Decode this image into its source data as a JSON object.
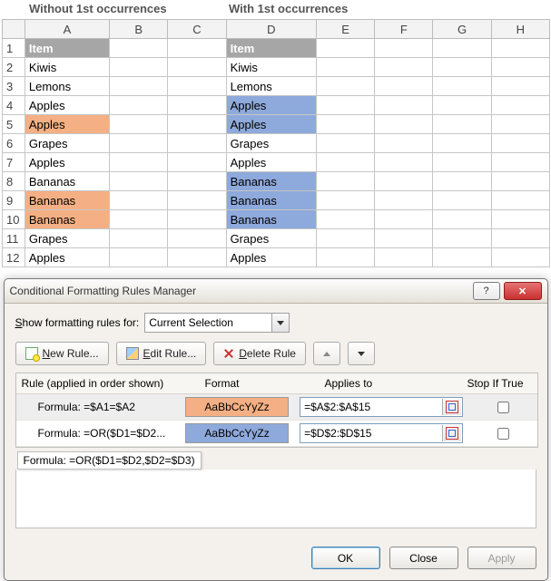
{
  "headings": {
    "left": "Without 1st occurrences",
    "right": "With 1st occurrences"
  },
  "columns": [
    "A",
    "B",
    "C",
    "D",
    "E",
    "F",
    "G",
    "H"
  ],
  "rows": [
    "1",
    "2",
    "3",
    "4",
    "5",
    "6",
    "7",
    "8",
    "9",
    "10",
    "11",
    "12"
  ],
  "colA": {
    "header": "Item",
    "values": [
      "Kiwis",
      "Lemons",
      "Apples",
      "Apples",
      "Grapes",
      "Apples",
      "Bananas",
      "Bananas",
      "Bananas",
      "Grapes",
      "Apples"
    ],
    "highlight_orange_rows": [
      5,
      9,
      10
    ]
  },
  "colD": {
    "header": "Item",
    "values": [
      "Kiwis",
      "Lemons",
      "Apples",
      "Apples",
      "Grapes",
      "Apples",
      "Bananas",
      "Bananas",
      "Bananas",
      "Grapes",
      "Apples"
    ],
    "highlight_blue_rows": [
      4,
      5,
      8,
      9,
      10
    ]
  },
  "dialog": {
    "title": "Conditional Formatting Rules Manager",
    "show_label_pre": "S",
    "show_label_post": "how formatting rules for:",
    "show_value": "Current Selection",
    "buttons": {
      "new": "New Rule...",
      "edit": "Edit Rule...",
      "delete": "Delete Rule"
    },
    "headers": {
      "rule": "Rule (applied in order shown)",
      "format": "Format",
      "applies": "Applies to",
      "stop": "Stop If True"
    },
    "rules": [
      {
        "formula_short": "Formula: =$A1=$A2",
        "format_sample": "AaBbCcYyZz",
        "format_style": "orange",
        "applies_to": "=$A$2:$A$15",
        "stop_if_true": false,
        "selected": true
      },
      {
        "formula_short": "Formula: =OR($D1=$D2...",
        "format_sample": "AaBbCcYyZz",
        "format_style": "blue",
        "applies_to": "=$D$2:$D$15",
        "stop_if_true": false,
        "selected": false
      }
    ],
    "tooltip": "Formula: =OR($D1=$D2,$D2=$D3)",
    "footer": {
      "ok": "OK",
      "close": "Close",
      "apply": "Apply"
    },
    "help_glyph": "?",
    "close_glyph": "✕"
  }
}
